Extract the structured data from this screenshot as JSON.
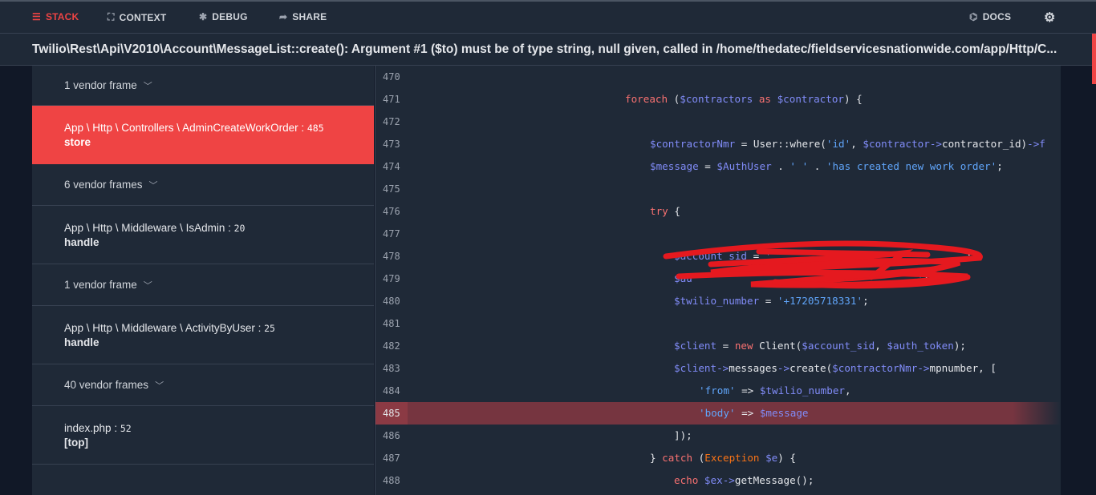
{
  "nav": {
    "stack": "STACK",
    "context": "CONTEXT",
    "debug": "DEBUG",
    "share": "SHARE",
    "docs": "DOCS"
  },
  "error_message": "Twilio\\Rest\\Api\\V2010\\Account\\MessageList::create(): Argument #1 ($to) must be of type string, null given, called in /home/thedatec/fieldservicesnationwide.com/app/Http/C...",
  "frames": [
    {
      "type": "vendor",
      "label": "1 vendor frame"
    },
    {
      "type": "frame",
      "class": "App \\ Http \\ Controllers \\ AdminCreateWorkOrder",
      "line": "485",
      "method": "store",
      "active": true
    },
    {
      "type": "vendor",
      "label": "6 vendor frames"
    },
    {
      "type": "frame",
      "class": "App \\ Http \\ Middleware \\ IsAdmin",
      "line": "20",
      "method": "handle"
    },
    {
      "type": "vendor",
      "label": "1 vendor frame"
    },
    {
      "type": "frame",
      "class": "App \\ Http \\ Middleware \\ ActivityByUser",
      "line": "25",
      "method": "handle"
    },
    {
      "type": "vendor",
      "label": "40 vendor frames"
    },
    {
      "type": "frame",
      "class": "index.php",
      "line": "52",
      "method": "[top]"
    }
  ],
  "code": {
    "highlight_line": "485",
    "lines": [
      {
        "n": "470",
        "indent": 0,
        "t": []
      },
      {
        "n": "471",
        "indent": 271,
        "t": [
          [
            "k",
            "foreach"
          ],
          [
            "p",
            " ("
          ],
          [
            "v",
            "$contractors"
          ],
          [
            "k",
            " as "
          ],
          [
            "v",
            "$contractor"
          ],
          [
            "p",
            ") {"
          ]
        ]
      },
      {
        "n": "472",
        "indent": 0,
        "t": []
      },
      {
        "n": "473",
        "indent": 302,
        "t": [
          [
            "v",
            "$contractorNmr"
          ],
          [
            "p",
            " = User::where("
          ],
          [
            "s",
            "'id'"
          ],
          [
            "p",
            ", "
          ],
          [
            "v",
            "$contractor"
          ],
          [
            "v",
            "->"
          ],
          [
            "p",
            "contractor_id)"
          ],
          [
            "v",
            "->f"
          ]
        ]
      },
      {
        "n": "474",
        "indent": 302,
        "t": [
          [
            "v",
            "$message"
          ],
          [
            "p",
            " = "
          ],
          [
            "v",
            "$AuthUser"
          ],
          [
            "p",
            " . "
          ],
          [
            "s",
            "' '"
          ],
          [
            "p",
            " . "
          ],
          [
            "s",
            "'has created new work order'"
          ],
          [
            "p",
            ";"
          ]
        ]
      },
      {
        "n": "475",
        "indent": 0,
        "t": []
      },
      {
        "n": "476",
        "indent": 302,
        "t": [
          [
            "k",
            "try"
          ],
          [
            "p",
            " {"
          ]
        ]
      },
      {
        "n": "477",
        "indent": 0,
        "t": []
      },
      {
        "n": "478",
        "indent": 332,
        "t": [
          [
            "v",
            "$account_sid"
          ],
          [
            "p",
            " = "
          ],
          [
            "s",
            "'                                "
          ],
          [
            "p",
            ";"
          ]
        ]
      },
      {
        "n": "479",
        "indent": 332,
        "t": [
          [
            "v",
            "$au"
          ],
          [
            "s",
            "                                     '"
          ],
          [
            "p",
            ";"
          ]
        ]
      },
      {
        "n": "480",
        "indent": 332,
        "t": [
          [
            "v",
            "$twilio_number"
          ],
          [
            "p",
            " = "
          ],
          [
            "s",
            "'+17205718331'"
          ],
          [
            "p",
            ";"
          ]
        ]
      },
      {
        "n": "481",
        "indent": 0,
        "t": []
      },
      {
        "n": "482",
        "indent": 332,
        "t": [
          [
            "v",
            "$client"
          ],
          [
            "p",
            " = "
          ],
          [
            "k",
            "new"
          ],
          [
            "p",
            " Client("
          ],
          [
            "v",
            "$account_sid"
          ],
          [
            "p",
            ", "
          ],
          [
            "v",
            "$auth_token"
          ],
          [
            "p",
            ");"
          ]
        ]
      },
      {
        "n": "483",
        "indent": 332,
        "t": [
          [
            "v",
            "$client"
          ],
          [
            "v",
            "->"
          ],
          [
            "p",
            "messages"
          ],
          [
            "v",
            "->"
          ],
          [
            "p",
            "create("
          ],
          [
            "v",
            "$contractorNmr"
          ],
          [
            "v",
            "->"
          ],
          [
            "p",
            "mpnumber, ["
          ]
        ]
      },
      {
        "n": "484",
        "indent": 363,
        "t": [
          [
            "s",
            "'from'"
          ],
          [
            "p",
            " => "
          ],
          [
            "v",
            "$twilio_number"
          ],
          [
            "p",
            ","
          ]
        ]
      },
      {
        "n": "485",
        "indent": 363,
        "t": [
          [
            "s",
            "'body'"
          ],
          [
            "p",
            " => "
          ],
          [
            "v",
            "$message"
          ]
        ]
      },
      {
        "n": "486",
        "indent": 332,
        "t": [
          [
            "p",
            "]);"
          ]
        ]
      },
      {
        "n": "487",
        "indent": 302,
        "t": [
          [
            "p",
            "} "
          ],
          [
            "k",
            "catch"
          ],
          [
            "p",
            " ("
          ],
          [
            "o",
            "Exception"
          ],
          [
            "v",
            " $e"
          ],
          [
            "p",
            ") {"
          ]
        ]
      },
      {
        "n": "488",
        "indent": 332,
        "t": [
          [
            "k",
            "echo"
          ],
          [
            "v",
            " $ex"
          ],
          [
            "v",
            "->"
          ],
          [
            "p",
            "getMessage();"
          ]
        ]
      }
    ]
  },
  "colors": {
    "accent": "#ef4444",
    "highlight": "#763540",
    "redaction": "#e5191f"
  }
}
